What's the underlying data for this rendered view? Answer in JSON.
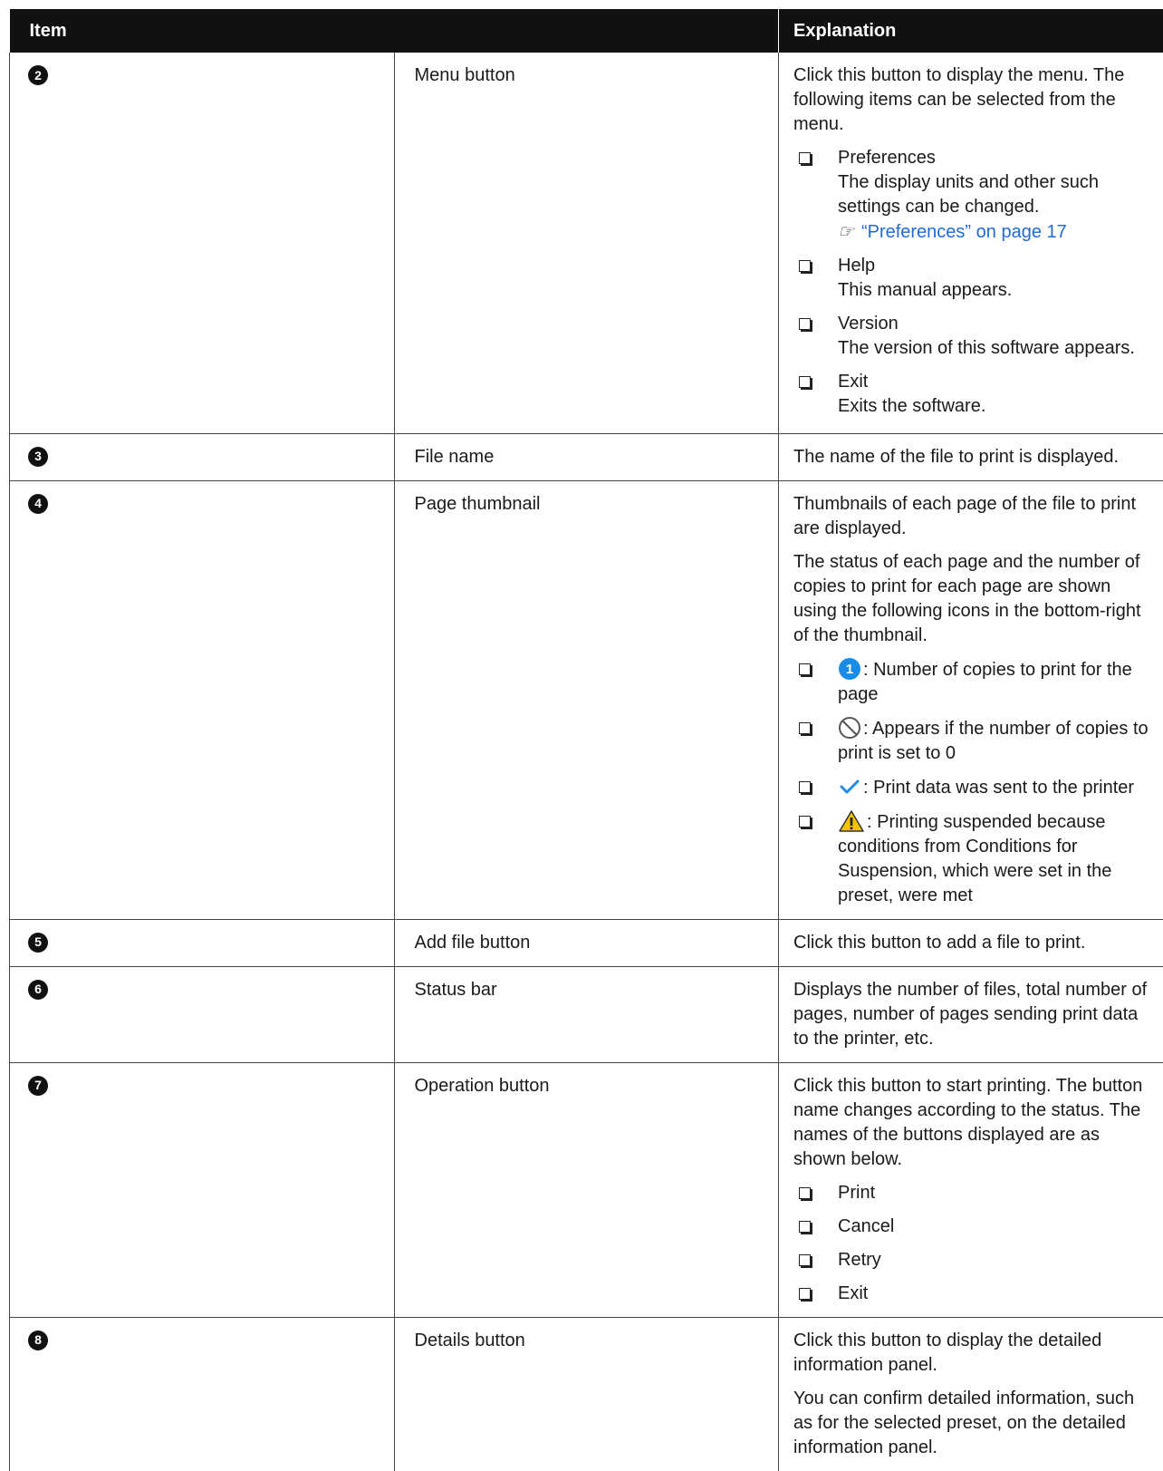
{
  "table": {
    "header_item": "Item",
    "header_explanation": "Explanation",
    "rows": [
      {
        "num": "2",
        "item": "Menu button",
        "intro": "Click this button to display the menu. The following items can be selected from the menu.",
        "bullets": [
          {
            "title": "Preferences",
            "desc": "The display units and other such settings can be changed.",
            "link": "“Preferences” on page 17"
          },
          {
            "title": "Help",
            "desc": "This manual appears."
          },
          {
            "title": "Version",
            "desc": "The version of this software appears."
          },
          {
            "title": "Exit",
            "desc": "Exits the software."
          }
        ]
      },
      {
        "num": "3",
        "item": "File name",
        "text": "The name of the file to print is displayed."
      },
      {
        "num": "4",
        "item": "Page thumbnail",
        "p1": "Thumbnails of each page of the file to print are displayed.",
        "p2": "The status of each page and the number of copies to print for each page are shown using the following icons in the bottom-right of the thumbnail.",
        "icon_items": [
          {
            "icon": "copies-number-icon",
            "icon_text": "1",
            "text": ": Number of copies to print for the page"
          },
          {
            "icon": "prohibited-icon",
            "text": ": Appears if the number of copies to print is set to 0"
          },
          {
            "icon": "checkmark-icon",
            "text": ": Print data was sent to the printer"
          },
          {
            "icon": "warning-icon",
            "text": ": Printing suspended because conditions from Conditions for Suspension, which were set in the preset, were met"
          }
        ]
      },
      {
        "num": "5",
        "item": "Add file button",
        "text": "Click this button to add a file to print."
      },
      {
        "num": "6",
        "item": "Status bar",
        "text": "Displays the number of files, total number of pages, number of pages sending print data to the printer, etc."
      },
      {
        "num": "7",
        "item": "Operation button",
        "text": "Click this button to start printing. The button name changes according to the status. The names of the buttons displayed are as shown below.",
        "bullets": [
          "Print",
          "Cancel",
          "Retry",
          "Exit"
        ]
      },
      {
        "num": "8",
        "item": "Details button",
        "p1": "Click this button to display the detailed information panel.",
        "p2": "You can confirm detailed information, such as for the selected preset, on the detailed information panel."
      }
    ]
  },
  "colors": {
    "header_bg": "#111111",
    "link": "#1e6bd6",
    "icon_blue": "#1a8ce8",
    "warning": "#f5c400"
  }
}
